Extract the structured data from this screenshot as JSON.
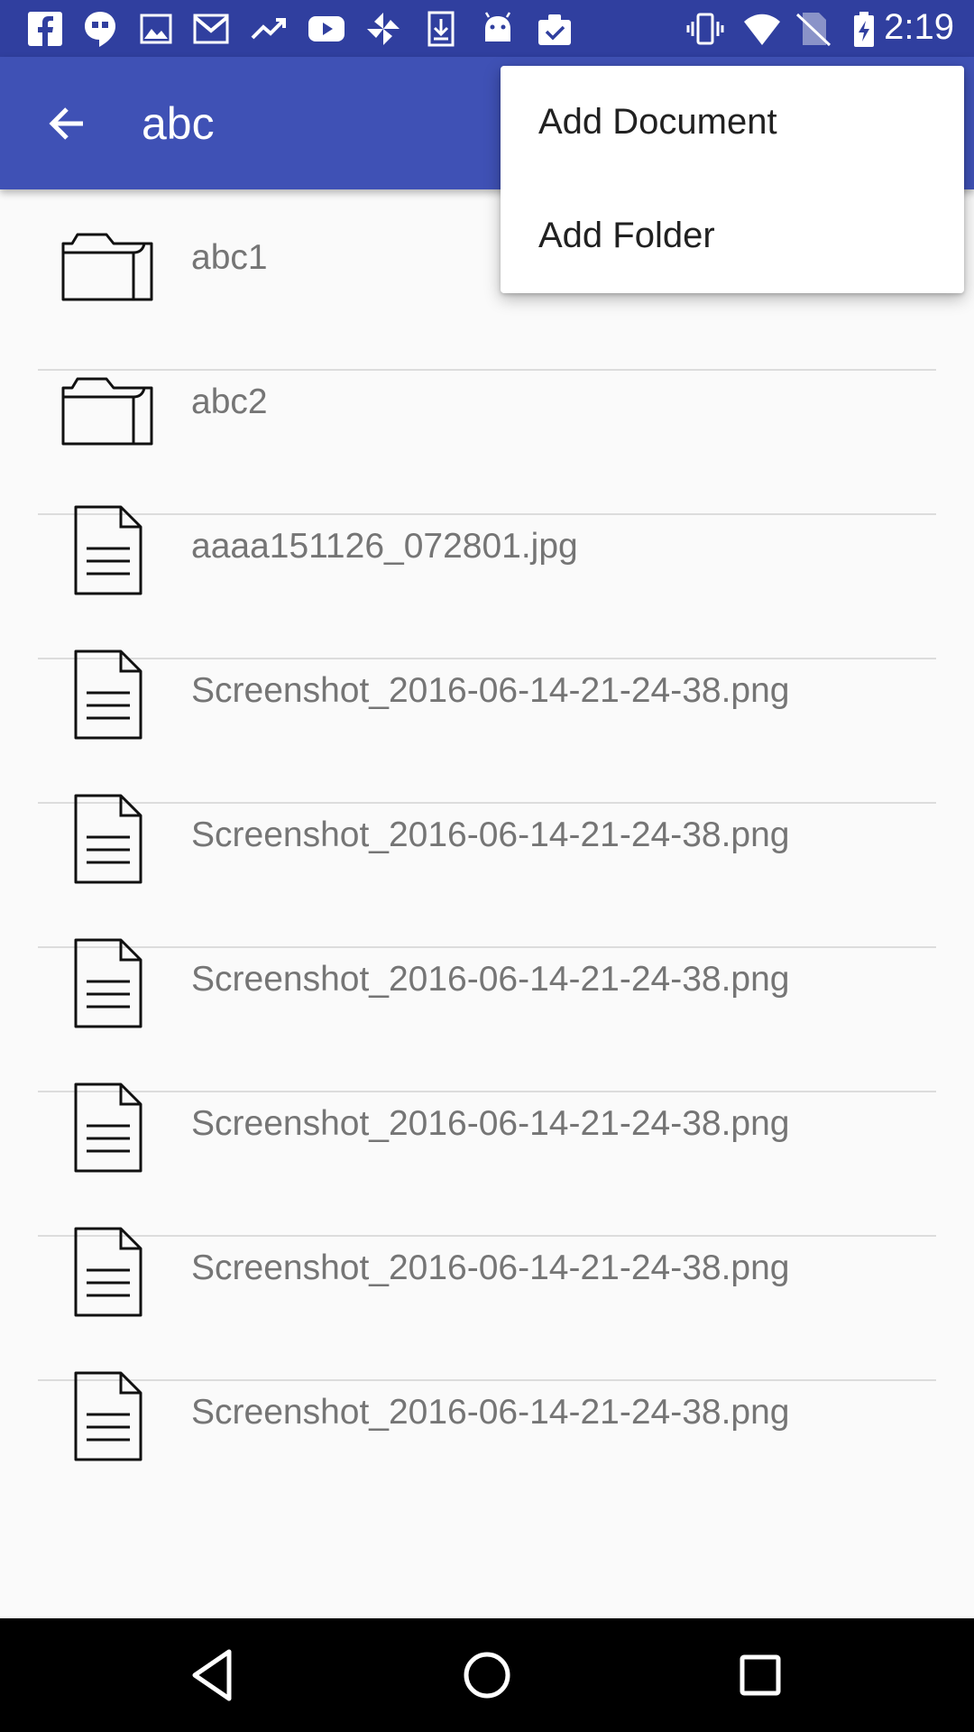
{
  "status_bar": {
    "time": "2:19",
    "left_icons": [
      "facebook-icon",
      "hangouts-icon",
      "gallery-icon",
      "gmail-icon",
      "trending-icon",
      "youtube-icon",
      "pinwheel-icon",
      "download-icon",
      "android-icon",
      "clipboard-check-icon"
    ],
    "right_icons": [
      "vibrate-icon",
      "wifi-icon",
      "no-sim-icon",
      "battery-charging-icon"
    ]
  },
  "app_bar": {
    "title": "abc",
    "back_icon": "arrow-back-icon"
  },
  "menu": {
    "items": [
      {
        "label": "Add Document"
      },
      {
        "label": "Add Folder"
      }
    ]
  },
  "files": [
    {
      "name": "abc1",
      "type": "folder"
    },
    {
      "name": "abc2",
      "type": "folder"
    },
    {
      "name": "aaaa151126_072801.jpg",
      "type": "file"
    },
    {
      "name": "Screenshot_2016-06-14-21-24-38.png",
      "type": "file"
    },
    {
      "name": "Screenshot_2016-06-14-21-24-38.png",
      "type": "file"
    },
    {
      "name": "Screenshot_2016-06-14-21-24-38.png",
      "type": "file"
    },
    {
      "name": "Screenshot_2016-06-14-21-24-38.png",
      "type": "file"
    },
    {
      "name": "Screenshot_2016-06-14-21-24-38.png",
      "type": "file"
    },
    {
      "name": "Screenshot_2016-06-14-21-24-38.png",
      "type": "file"
    }
  ],
  "nav_bar": {
    "buttons": [
      "back-triangle-icon",
      "home-circle-icon",
      "recents-square-icon"
    ]
  },
  "colors": {
    "status_bar": "#303f9f",
    "app_bar": "#3f51b5",
    "background": "#fafafa",
    "item_text": "#757575"
  }
}
